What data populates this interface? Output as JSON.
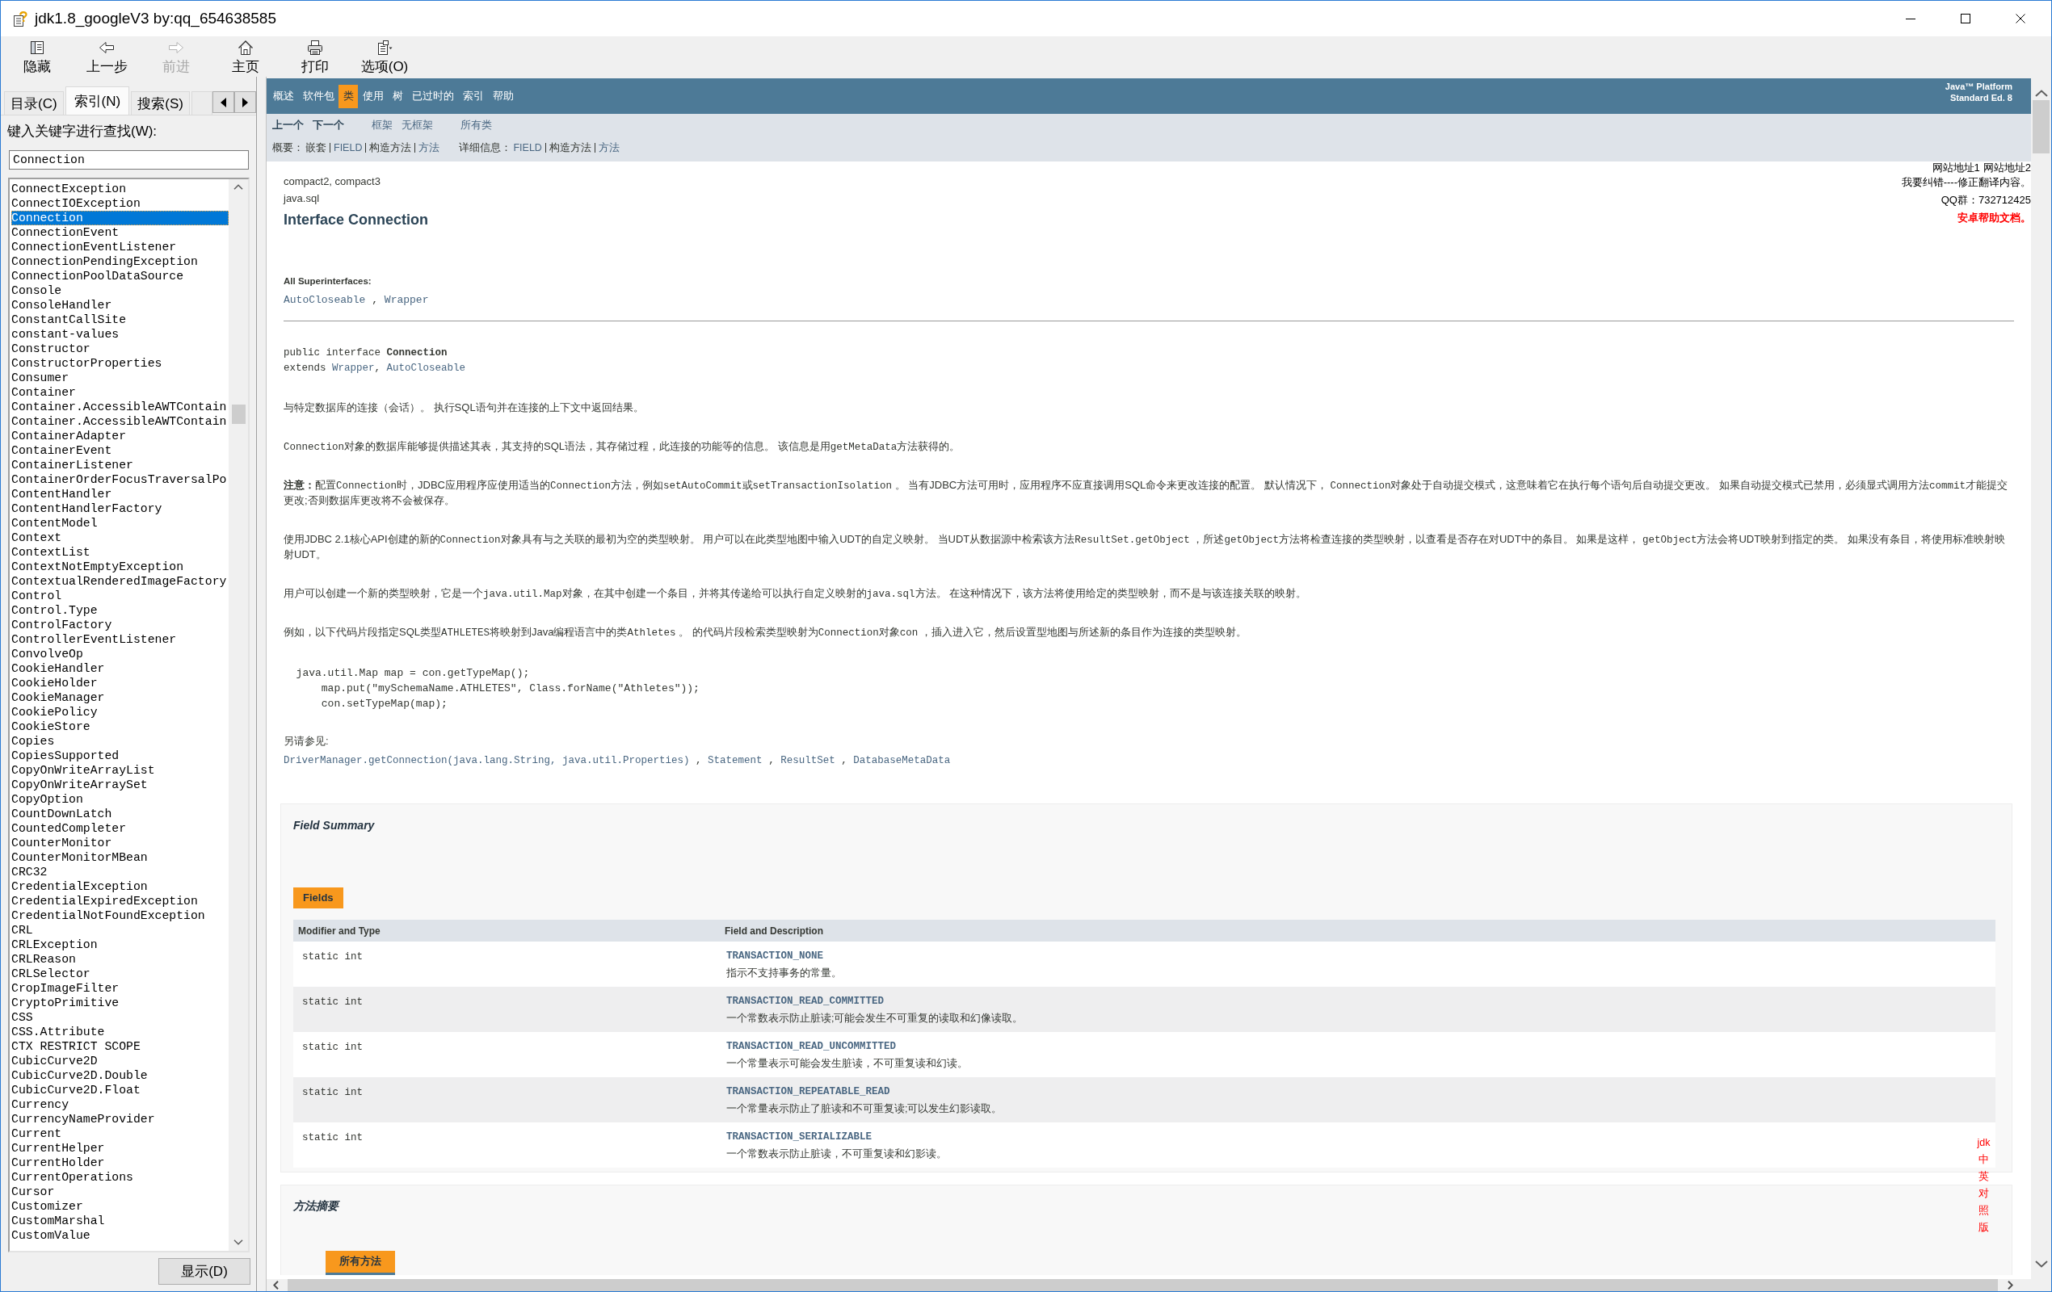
{
  "window": {
    "title": "jdk1.8_googleV3 by:qq_654638585"
  },
  "toolbar": [
    {
      "kind": "hide",
      "label": "隐藏",
      "disabled": false
    },
    {
      "kind": "back",
      "label": "上一步",
      "disabled": false
    },
    {
      "kind": "forward",
      "label": "前进",
      "disabled": true
    },
    {
      "kind": "home",
      "label": "主页",
      "disabled": false
    },
    {
      "kind": "print",
      "label": "打印",
      "disabled": false
    },
    {
      "kind": "options",
      "label": "选项(O)",
      "disabled": false
    }
  ],
  "navigation_pane": {
    "tabs": [
      {
        "label": "目录(C)",
        "selected": false
      },
      {
        "label": "索引(N)",
        "selected": true
      },
      {
        "label": "搜索(S)",
        "selected": false
      },
      {
        "selected": false
      }
    ],
    "search_label": "键入关键字进行查找(W):",
    "search": {
      "value": "Connection"
    },
    "index_items": [
      {
        "label": "ConnectException",
        "selected": false
      },
      {
        "label": "ConnectIOException",
        "selected": false
      },
      {
        "label": "Connection",
        "selected": true
      },
      {
        "label": "ConnectionEvent",
        "selected": false
      },
      {
        "label": "ConnectionEventListener",
        "selected": false
      },
      {
        "label": "ConnectionPendingException",
        "selected": false
      },
      {
        "label": "ConnectionPoolDataSource",
        "selected": false
      },
      {
        "label": "Console",
        "selected": false
      },
      {
        "label": "ConsoleHandler",
        "selected": false
      },
      {
        "label": "ConstantCallSite",
        "selected": false
      },
      {
        "label": "constant-values",
        "selected": false
      },
      {
        "label": "Constructor",
        "selected": false
      },
      {
        "label": "ConstructorProperties",
        "selected": false
      },
      {
        "label": "Consumer",
        "selected": false
      },
      {
        "label": "Container",
        "selected": false
      },
      {
        "label": "Container.AccessibleAWTContain",
        "selected": false
      },
      {
        "label": "Container.AccessibleAWTContain",
        "selected": false
      },
      {
        "label": "ContainerAdapter",
        "selected": false
      },
      {
        "label": "ContainerEvent",
        "selected": false
      },
      {
        "label": "ContainerListener",
        "selected": false
      },
      {
        "label": "ContainerOrderFocusTraversalPo",
        "selected": false
      },
      {
        "label": "ContentHandler",
        "selected": false
      },
      {
        "label": "ContentHandlerFactory",
        "selected": false
      },
      {
        "label": "ContentModel",
        "selected": false
      },
      {
        "label": "Context",
        "selected": false
      },
      {
        "label": "ContextList",
        "selected": false
      },
      {
        "label": "ContextNotEmptyException",
        "selected": false
      },
      {
        "label": "ContextualRenderedImageFactory",
        "selected": false
      },
      {
        "label": "Control",
        "selected": false
      },
      {
        "label": "Control.Type",
        "selected": false
      },
      {
        "label": "ControlFactory",
        "selected": false
      },
      {
        "label": "ControllerEventListener",
        "selected": false
      },
      {
        "label": "ConvolveOp",
        "selected": false
      },
      {
        "label": "CookieHandler",
        "selected": false
      },
      {
        "label": "CookieHolder",
        "selected": false
      },
      {
        "label": "CookieManager",
        "selected": false
      },
      {
        "label": "CookiePolicy",
        "selected": false
      },
      {
        "label": "CookieStore",
        "selected": false
      },
      {
        "label": "Copies",
        "selected": false
      },
      {
        "label": "CopiesSupported",
        "selected": false
      },
      {
        "label": "CopyOnWriteArrayList",
        "selected": false
      },
      {
        "label": "CopyOnWriteArraySet",
        "selected": false
      },
      {
        "label": "CopyOption",
        "selected": false
      },
      {
        "label": "CountDownLatch",
        "selected": false
      },
      {
        "label": "CountedCompleter",
        "selected": false
      },
      {
        "label": "CounterMonitor",
        "selected": false
      },
      {
        "label": "CounterMonitorMBean",
        "selected": false
      },
      {
        "label": "CRC32",
        "selected": false
      },
      {
        "label": "CredentialException",
        "selected": false
      },
      {
        "label": "CredentialExpiredException",
        "selected": false
      },
      {
        "label": "CredentialNotFoundException",
        "selected": false
      },
      {
        "label": "CRL",
        "selected": false
      },
      {
        "label": "CRLException",
        "selected": false
      },
      {
        "label": "CRLReason",
        "selected": false
      },
      {
        "label": "CRLSelector",
        "selected": false
      },
      {
        "label": "CropImageFilter",
        "selected": false
      },
      {
        "label": "CryptoPrimitive",
        "selected": false
      },
      {
        "label": "CSS",
        "selected": false
      },
      {
        "label": "CSS.Attribute",
        "selected": false
      },
      {
        "label": "CTX RESTRICT SCOPE",
        "selected": false
      },
      {
        "label": "CubicCurve2D",
        "selected": false
      },
      {
        "label": "CubicCurve2D.Double",
        "selected": false
      },
      {
        "label": "CubicCurve2D.Float",
        "selected": false
      },
      {
        "label": "Currency",
        "selected": false
      },
      {
        "label": "CurrencyNameProvider",
        "selected": false
      },
      {
        "label": "Current",
        "selected": false
      },
      {
        "label": "CurrentHelper",
        "selected": false
      },
      {
        "label": "CurrentHolder",
        "selected": false
      },
      {
        "label": "CurrentOperations",
        "selected": false
      },
      {
        "label": "Cursor",
        "selected": false
      },
      {
        "label": "Customizer",
        "selected": false
      },
      {
        "label": "CustomMarshal",
        "selected": false
      },
      {
        "label": "CustomValue",
        "selected": false
      }
    ],
    "display_button": "显示(D)"
  },
  "document": {
    "top_nav": {
      "items": [
        {
          "label": "概述",
          "selected": false
        },
        {
          "label": "软件包",
          "selected": false
        },
        {
          "label": "类",
          "selected": true
        },
        {
          "label": "使用",
          "selected": false
        },
        {
          "label": "树",
          "selected": false
        },
        {
          "label": "已过时的",
          "selected": false
        },
        {
          "label": "索引",
          "selected": false
        },
        {
          "label": "帮助",
          "selected": false
        }
      ],
      "platform": [
        "Java™ Platform",
        "Standard Ed. 8"
      ]
    },
    "sub_nav": {
      "groups": [
        [
          {
            "text": "上一个",
            "kind": "strong"
          },
          {
            "text": "下一个",
            "kind": "strong"
          }
        ],
        [
          {
            "text": "框架",
            "kind": "link"
          },
          {
            "text": "无框架",
            "kind": "link"
          }
        ],
        [
          {
            "text": "所有类",
            "kind": "link"
          }
        ]
      ],
      "summary": {
        "label": "概要：",
        "items": [
          {
            "text": "嵌套",
            "kind": "plain"
          },
          {
            "text": "FIELD",
            "kind": "link"
          },
          {
            "text": "构造方法",
            "kind": "plain"
          },
          {
            "text": "方法",
            "kind": "link"
          }
        ]
      },
      "detail": {
        "label": "详细信息：",
        "items": [
          {
            "text": "FIELD",
            "kind": "link"
          },
          {
            "text": "构造方法",
            "kind": "plain"
          },
          {
            "text": "方法",
            "kind": "link"
          }
        ]
      }
    },
    "header": {
      "profiles": "compact2, compact3",
      "package": "java.sql",
      "title": "Interface Connection"
    },
    "notes": [
      {
        "kind": "link",
        "texts": [
          "网站地址1",
          "网站地址2"
        ]
      },
      {
        "kind": "link",
        "texts": [
          "我要纠错----修正翻译内容。"
        ]
      },
      {
        "kind": "text",
        "texts": [
          "QQ群：732712425"
        ]
      },
      {
        "kind": "alert",
        "texts": [
          "安卓帮助文档。"
        ]
      }
    ],
    "superinterfaces": {
      "label": "All Superinterfaces:",
      "line": [
        {
          "kind": "link",
          "text": "AutoCloseable"
        },
        {
          "kind": "text",
          "text": " , "
        },
        {
          "kind": "link",
          "text": "Wrapper"
        }
      ]
    },
    "signature": [
      [
        {
          "kind": "text",
          "text": "public interface "
        },
        {
          "kind": "bold",
          "text": "Connection"
        }
      ],
      [
        {
          "kind": "text",
          "text": "extends "
        },
        {
          "kind": "link",
          "text": "Wrapper"
        },
        {
          "kind": "text",
          "text": ", "
        },
        {
          "kind": "link",
          "text": "AutoCloseable"
        }
      ]
    ],
    "description": [
      [
        {
          "kind": "text",
          "text": "与特定数据库的连接（会话）。 执行SQL语句并在连接的上下文中返回结果。"
        }
      ],
      [
        {
          "kind": "code",
          "text": "Connection"
        },
        {
          "kind": "text",
          "text": "对象的数据库能够提供描述其表，其支持的SQL语法，其存储过程，此连接的功能等的信息。 该信息是用"
        },
        {
          "kind": "code",
          "text": "getMetaData"
        },
        {
          "kind": "text",
          "text": "方法获得的。"
        }
      ],
      [
        {
          "kind": "bold",
          "text": "注意："
        },
        {
          "kind": "text",
          "text": "配置"
        },
        {
          "kind": "code",
          "text": "Connection"
        },
        {
          "kind": "text",
          "text": "时，JDBC应用程序应使用适当的"
        },
        {
          "kind": "code",
          "text": "Connection"
        },
        {
          "kind": "text",
          "text": "方法，例如"
        },
        {
          "kind": "code",
          "text": "setAutoCommit"
        },
        {
          "kind": "text",
          "text": "或"
        },
        {
          "kind": "code",
          "text": "setTransactionIsolation"
        },
        {
          "kind": "text",
          "text": " 。 当有JDBC方法可用时，应用程序不应直接调用SQL命令来更改连接的配置。 默认情况下， "
        },
        {
          "kind": "code",
          "text": "Connection"
        },
        {
          "kind": "text",
          "text": "对象处于自动提交模式，这意味着它在执行每个语句后自动提交更改。 如果自动提交模式已禁用，必须显式调用方法"
        },
        {
          "kind": "code",
          "text": "commit"
        },
        {
          "kind": "text",
          "text": "才能提交更改;否则数据库更改将不会被保存。"
        }
      ],
      [
        {
          "kind": "text",
          "text": "使用JDBC 2.1核心API创建的新的"
        },
        {
          "kind": "code",
          "text": "Connection"
        },
        {
          "kind": "text",
          "text": "对象具有与之关联的最初为空的类型映射。 用户可以在此类型地图中输入UDT的自定义映射。 当UDT从数据源中检索该方法"
        },
        {
          "kind": "code",
          "text": "ResultSet.getObject"
        },
        {
          "kind": "text",
          "text": " ，所述"
        },
        {
          "kind": "code",
          "text": "getObject"
        },
        {
          "kind": "text",
          "text": "方法将检查连接的类型映射，以查看是否存在对UDT中的条目。 如果是这样， "
        },
        {
          "kind": "code",
          "text": "getObject"
        },
        {
          "kind": "text",
          "text": "方法会将UDT映射到指定的类。 如果没有条目，将使用标准映射映射UDT。"
        }
      ],
      [
        {
          "kind": "text",
          "text": "用户可以创建一个新的类型映射，它是一个"
        },
        {
          "kind": "code",
          "text": "java.util.Map"
        },
        {
          "kind": "text",
          "text": "对象，在其中创建一个条目，并将其传递给可以执行自定义映射的"
        },
        {
          "kind": "code",
          "text": "java.sql"
        },
        {
          "kind": "text",
          "text": "方法。 在这种情况下，该方法将使用给定的类型映射，而不是与该连接关联的映射。"
        }
      ],
      [
        {
          "kind": "text",
          "text": "例如，以下代码片段指定SQL类型"
        },
        {
          "kind": "code",
          "text": "ATHLETES"
        },
        {
          "kind": "text",
          "text": "将映射到Java编程语言中的类"
        },
        {
          "kind": "code",
          "text": "Athletes"
        },
        {
          "kind": "text",
          "text": " 。 的代码片段检索类型映射为"
        },
        {
          "kind": "code",
          "text": "Connection"
        },
        {
          "kind": "text",
          "text": "对象"
        },
        {
          "kind": "code",
          "text": "con"
        },
        {
          "kind": "text",
          "text": " ，插入进入它，然后设置型地图与所述新的条目作为连接的类型映射。"
        }
      ]
    ],
    "code_sample": [
      "  java.util.Map map = con.getTypeMap();",
      "      map.put(\"mySchemaName.ATHLETES\", Class.forName(\"Athletes\"));",
      "      con.setTypeMap(map);"
    ],
    "see_also": {
      "label": "另请参见:",
      "line": [
        {
          "kind": "link",
          "text": "DriverManager.getConnection(java.lang.String, java.util.Properties)"
        },
        {
          "kind": "text",
          "text": " , "
        },
        {
          "kind": "link",
          "text": "Statement"
        },
        {
          "kind": "text",
          "text": " , "
        },
        {
          "kind": "link",
          "text": "ResultSet"
        },
        {
          "kind": "text",
          "text": " , "
        },
        {
          "kind": "link",
          "text": "DatabaseMetaData"
        }
      ]
    },
    "field_summary": {
      "title": "Field Summary",
      "tab": "Fields",
      "columns": [
        "Modifier and Type",
        "Field and Description"
      ],
      "rows": [
        {
          "type": "static int",
          "name": "TRANSACTION_NONE",
          "description": "指示不支持事务的常量。"
        },
        {
          "type": "static int",
          "name": "TRANSACTION_READ_COMMITTED",
          "description": "一个常数表示防止脏读;可能会发生不可重复的读取和幻像读取。"
        },
        {
          "type": "static int",
          "name": "TRANSACTION_READ_UNCOMMITTED",
          "description": "一个常量表示可能会发生脏读，不可重复读和幻读。"
        },
        {
          "type": "static int",
          "name": "TRANSACTION_REPEATABLE_READ",
          "description": "一个常量表示防止了脏读和不可重复读;可以发生幻影读取。"
        },
        {
          "type": "static int",
          "name": "TRANSACTION_SERIALIZABLE",
          "description": "一个常数表示防止脏读，不可重复读和幻影读。"
        }
      ]
    },
    "method_summary": {
      "title": "方法摘要",
      "tab": "所有方法"
    },
    "side_tag": "jdk中英对照版"
  }
}
